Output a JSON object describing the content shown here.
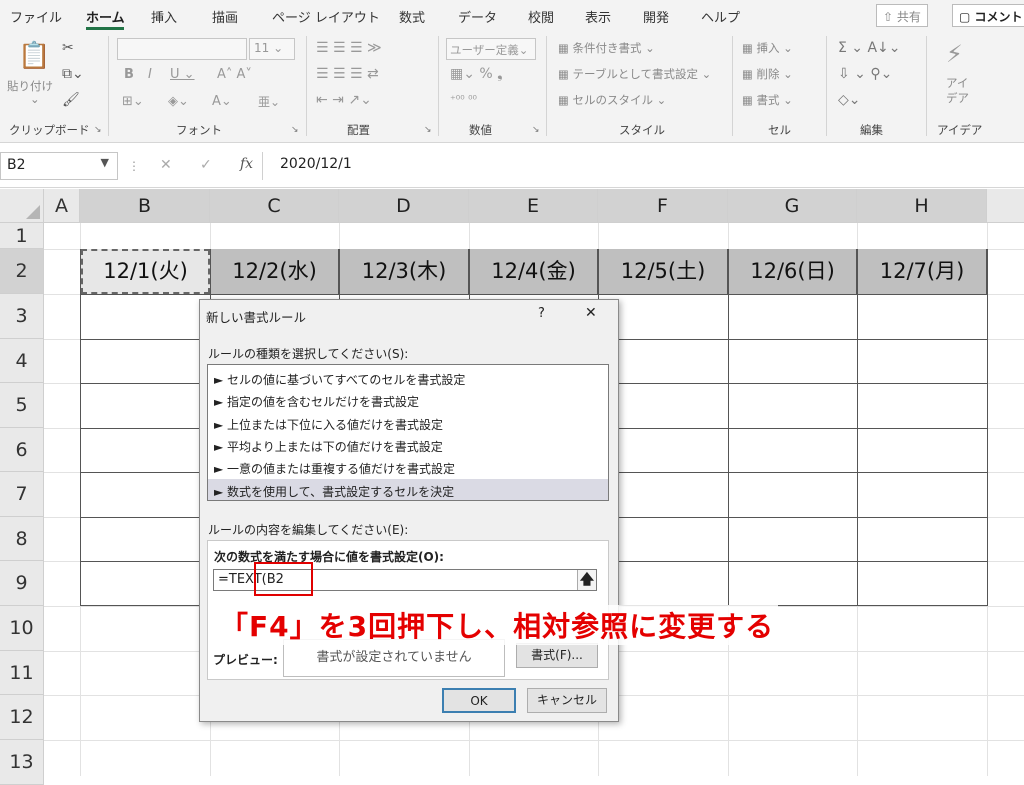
{
  "tabs": [
    "ファイル",
    "ホーム",
    "挿入",
    "描画",
    "ページ レイアウト",
    "数式",
    "データ",
    "校閲",
    "表示",
    "開発",
    "ヘルプ"
  ],
  "share_label": "共有",
  "comment_label": "コメント",
  "ribbon": {
    "paste_label": "貼り付け",
    "font_name": "",
    "font_size": "11",
    "number_format": "ユーザー定義",
    "cond_format": "条件付き書式",
    "table_format": "テーブルとして書式設定",
    "cell_style": "セルのスタイル",
    "insert": "挿入",
    "delete": "削除",
    "format": "書式",
    "idea_label": "アイ\nデア",
    "groups": [
      "クリップボード",
      "フォント",
      "配置",
      "数値",
      "スタイル",
      "セル",
      "編集",
      "アイデア"
    ]
  },
  "namebox": "B2",
  "formula": "2020/12/1",
  "columns": [
    "A",
    "B",
    "C",
    "D",
    "E",
    "F",
    "G",
    "H"
  ],
  "rows": [
    "1",
    "2",
    "3",
    "4",
    "5",
    "6",
    "7",
    "8",
    "9",
    "10",
    "11",
    "12",
    "13"
  ],
  "row2_cells": [
    "12/1(火)",
    "12/2(水)",
    "12/3(木)",
    "12/4(金)",
    "12/5(土)",
    "12/6(日)",
    "12/7(月)"
  ],
  "dialog": {
    "title": "新しい書式ルール",
    "help": "?",
    "close": "✕",
    "rule_type_label": "ルールの種類を選択してください(S):",
    "rules": [
      "► セルの値に基づいてすべてのセルを書式設定",
      "► 指定の値を含むセルだけを書式設定",
      "► 上位または下位に入る値だけを書式設定",
      "► 平均より上または下の値だけを書式設定",
      "► 一意の値または重複する値だけを書式設定",
      "► 数式を使用して、書式設定するセルを決定"
    ],
    "edit_label": "ルールの内容を編集してください(E):",
    "formula_label": "次の数式を満たす場合に値を書式設定(O):",
    "formula_value": "=TEXT(B2",
    "preview_label": "プレビュー:",
    "preview_text": "書式が設定されていません",
    "format_button": "書式(F)...",
    "ok": "OK",
    "cancel": "キャンセル"
  },
  "annotation": "「F4」を3回押下し、相対参照に変更する",
  "colors": {
    "accent": "#217346",
    "annotation": "#e40000",
    "selected_cell": "#bfbfbf"
  }
}
